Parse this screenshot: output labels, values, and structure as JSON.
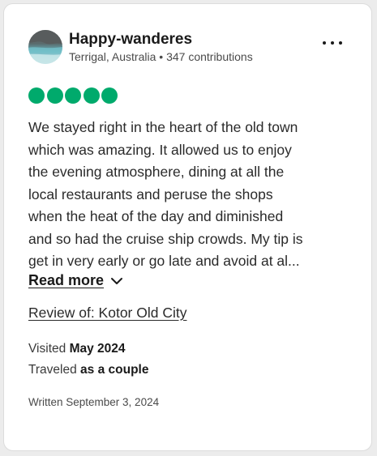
{
  "reviewer": {
    "name": "Happy-wanderes",
    "location": "Terrigal, Australia",
    "separator": "•",
    "contributions": "347 contributions"
  },
  "rating": {
    "value": 5,
    "max": 5,
    "color": "#00aa6c"
  },
  "review": {
    "lines": [
      "We stayed right in the heart of the old town",
      "which was amazing. It allowed us to enjoy",
      "the evening atmosphere, dining at all the",
      "local restaurants and peruse the shops",
      "when the heat of the day and diminished",
      "and so had the cruise ship crowds. My tip is",
      "get in very early or go late and avoid at al..."
    ],
    "read_more_label": "Read more",
    "review_of": "Review of: Kotor Old City"
  },
  "trip": {
    "visited_label": "Visited",
    "visited_value": "May 2024",
    "traveled_label": "Traveled",
    "traveled_value": "as a couple"
  },
  "written": "Written September 3, 2024",
  "icons": {
    "more": "more-horizontal-icon",
    "chevron": "chevron-down-icon"
  }
}
